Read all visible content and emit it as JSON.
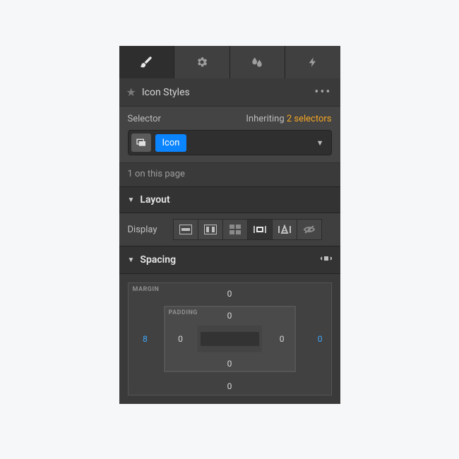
{
  "header": {
    "title": "Icon Styles"
  },
  "selector": {
    "label": "Selector",
    "inheriting_prefix": "Inheriting ",
    "inheriting_count": "2 selectors",
    "tag": "Icon",
    "count_on_page": "1 on this page"
  },
  "sections": {
    "layout": "Layout",
    "spacing": "Spacing",
    "display_label": "Display"
  },
  "spacing": {
    "margin_label": "MARGIN",
    "padding_label": "PADDING",
    "margin": {
      "top": "0",
      "right": "0",
      "bottom": "0",
      "left": "8"
    },
    "padding": {
      "top": "0",
      "right": "0",
      "bottom": "0",
      "left": "0"
    }
  },
  "colors": {
    "accent": "#0a84ff",
    "link": "#f5a623",
    "value_highlight": "#3fa9ff"
  }
}
